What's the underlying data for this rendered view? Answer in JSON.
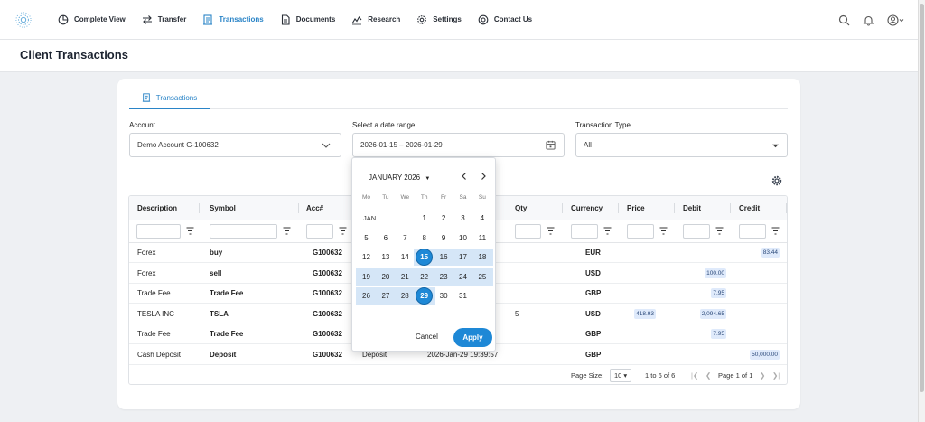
{
  "nav": {
    "items": [
      {
        "label": "Complete View",
        "icon": "pie-chart-icon"
      },
      {
        "label": "Transfer",
        "icon": "transfer-arrows-icon"
      },
      {
        "label": "Transactions",
        "icon": "ledger-icon",
        "active": true
      },
      {
        "label": "Documents",
        "icon": "document-icon"
      },
      {
        "label": "Research",
        "icon": "chart-line-icon"
      },
      {
        "label": "Settings",
        "icon": "gear-icon"
      },
      {
        "label": "Contact Us",
        "icon": "headset-icon"
      }
    ]
  },
  "page": {
    "title": "Client Transactions"
  },
  "tabs": [
    {
      "label": "Transactions"
    }
  ],
  "filters": {
    "account_label": "Account",
    "account_value": "Demo  Account G-100632",
    "date_label": "Select a date range",
    "date_value": "2026-01-15 – 2026-01-29",
    "type_label": "Transaction Type",
    "type_value": "All"
  },
  "grid": {
    "columns": [
      "Description",
      "Symbol",
      "Acc#",
      "Qty",
      "Currency",
      "Price",
      "Debit",
      "Credit"
    ],
    "rows": [
      {
        "description": "Forex",
        "symbol": "buy",
        "acc": "G100632",
        "type": "",
        "date": "",
        "qty": "",
        "currency": "EUR",
        "price": "",
        "debit": "",
        "credit": "83.44"
      },
      {
        "description": "Forex",
        "symbol": "sell",
        "acc": "G100632",
        "type": "",
        "date": "",
        "qty": "",
        "currency": "USD",
        "price": "",
        "debit": "100.00",
        "credit": ""
      },
      {
        "description": "Trade Fee",
        "symbol": "Trade Fee",
        "acc": "G100632",
        "type": "",
        "date": "",
        "qty": "",
        "currency": "GBP",
        "price": "",
        "debit": "7.95",
        "credit": ""
      },
      {
        "description": "TESLA INC",
        "symbol": "TSLA",
        "acc": "G100632",
        "type": "",
        "date": "",
        "qty": "5",
        "currency": "USD",
        "price": "418.93",
        "debit": "2,094.65",
        "credit": ""
      },
      {
        "description": "Trade Fee",
        "symbol": "Trade Fee",
        "acc": "G100632",
        "type": "",
        "date": "",
        "qty": "",
        "currency": "GBP",
        "price": "",
        "debit": "7.95",
        "credit": ""
      },
      {
        "description": "Cash Deposit",
        "symbol": "Deposit",
        "acc": "G100632",
        "type": "Deposit",
        "date": "2026-Jan-29 19:39:57",
        "qty": "",
        "currency": "GBP",
        "price": "",
        "debit": "",
        "credit": "50,000.00"
      }
    ],
    "pager": {
      "page_size_label": "Page Size:",
      "page_size": "10",
      "range": "1 to 6 of 6",
      "page": "Page 1 of 1"
    }
  },
  "calendar": {
    "month": "JANUARY 2026",
    "weekdays": [
      "Mo",
      "Tu",
      "We",
      "Th",
      "Fr",
      "Sa",
      "Su"
    ],
    "month_short": "JAN",
    "weeks": [
      [
        "",
        "",
        "",
        "1",
        "2",
        "3",
        "4"
      ],
      [
        "5",
        "6",
        "7",
        "8",
        "9",
        "10",
        "11"
      ],
      [
        "12",
        "13",
        "14",
        "15",
        "16",
        "17",
        "18"
      ],
      [
        "19",
        "20",
        "21",
        "22",
        "23",
        "24",
        "25"
      ],
      [
        "26",
        "27",
        "28",
        "29",
        "30",
        "31",
        ""
      ]
    ],
    "range_start": "15",
    "range_end": "29",
    "cancel_label": "Cancel",
    "apply_label": "Apply"
  },
  "colors": {
    "accent": "#2a84c7",
    "selected": "#1e88d6",
    "range": "#d5e6f7"
  }
}
